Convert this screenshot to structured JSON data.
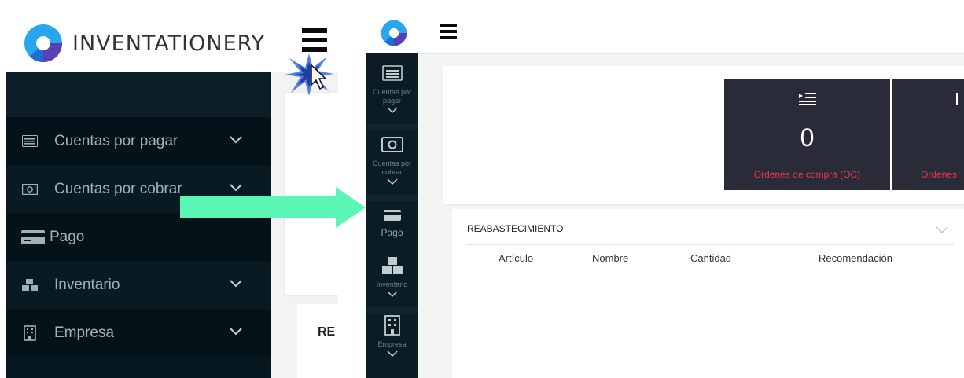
{
  "left": {
    "brand": "INVENTATIONERY",
    "sidebar": {
      "items": [
        {
          "label": "Cuentas por pagar",
          "icon": "list-card-icon",
          "has_chevron": true
        },
        {
          "label": "Cuentas por cobrar",
          "icon": "money-bill-icon",
          "has_chevron": true
        },
        {
          "label": "Pago",
          "icon": "credit-card-icon",
          "has_chevron": false
        },
        {
          "label": "Inventario",
          "icon": "cubes-icon",
          "has_chevron": true
        },
        {
          "label": "Empresa",
          "icon": "building-icon",
          "has_chevron": true
        }
      ]
    },
    "partial_heading": "RE"
  },
  "right": {
    "sidebar": {
      "items": [
        {
          "label": "Cuentas por pagar",
          "icon": "list-card-icon"
        },
        {
          "label": "Cuentas por cobrar",
          "icon": "money-bill-icon"
        },
        {
          "label": "Pago",
          "icon": "credit-card-icon"
        },
        {
          "label": "Inventario",
          "icon": "cubes-icon"
        },
        {
          "label": "Empresa",
          "icon": "building-icon"
        }
      ]
    },
    "kpis": [
      {
        "value": "0",
        "label": "Ordenes de compra (OC)",
        "icon": "indent-list-icon"
      },
      {
        "value": "",
        "label": "Ordenes",
        "icon": "list-icon"
      }
    ],
    "reabastecimiento": {
      "title": "REABASTECIMIENTO",
      "columns": [
        "Artículo",
        "Nombre",
        "Cantidad",
        "Recomendación"
      ]
    }
  },
  "colors": {
    "sidebar_bg": "#071920",
    "kpi_bg": "#2a2b38",
    "kpi_label": "#ea3455",
    "arrow": "#5bf5b6",
    "logo_blue": "#1f8fe0",
    "logo_purple": "#5a3fb5"
  }
}
